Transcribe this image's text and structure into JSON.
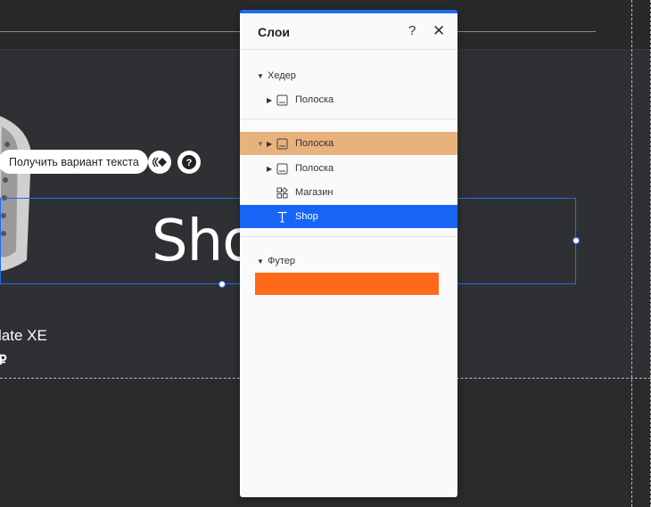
{
  "canvas": {
    "ai_button_label": "Получить вариант текста",
    "shop_text": "Shop",
    "product_name": "late XE",
    "product_price": "₽"
  },
  "layers_panel": {
    "title": "Слои",
    "help_glyph": "?",
    "close_glyph": "✕",
    "sections": {
      "header": "Хедер",
      "footer": "Футер"
    },
    "rows": {
      "header_strip": "Полоска",
      "dragged_strip": "Полоска",
      "strip": "Полоска",
      "store": "Магазин",
      "shop": "Shop"
    }
  },
  "colors": {
    "accent": "#1765f5",
    "drag_highlight": "#e8b07a",
    "footer_bar": "#fe6a1a",
    "canvas_bg": "#2f3033"
  },
  "icons": {
    "caret_right": "▶",
    "caret_down": "▼",
    "strip_icon": "strip-layout-icon",
    "store_icon": "grid-apps-icon",
    "text_icon": "text-t-icon"
  }
}
